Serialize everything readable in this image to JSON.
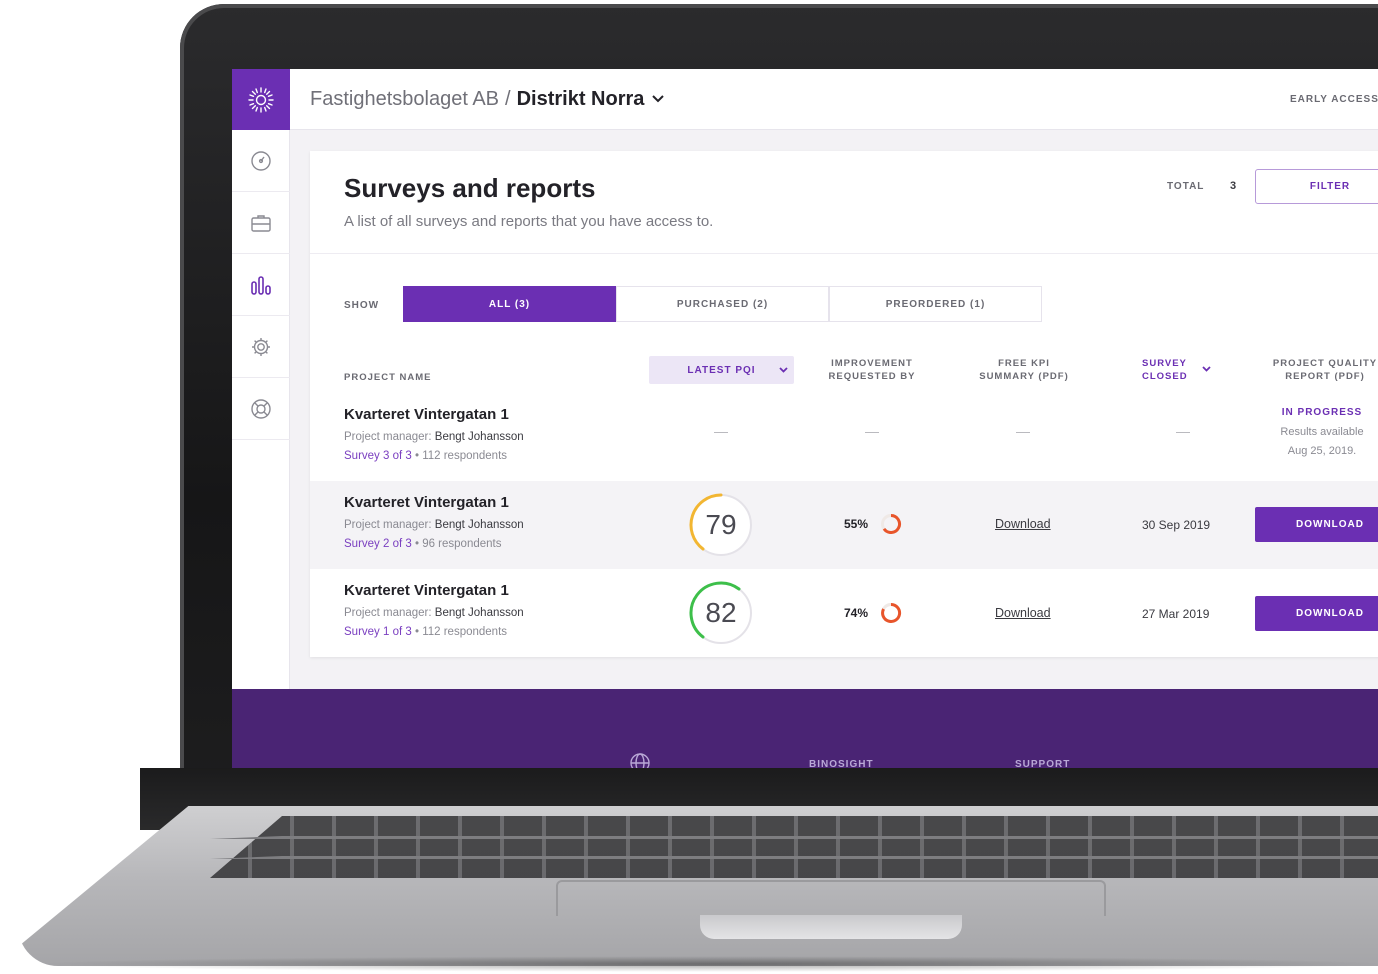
{
  "header": {
    "org": "Fastighetsbolaget AB",
    "separator": "/",
    "district": "Distrikt Norra",
    "early_access": "EARLY ACCESS"
  },
  "sidebar": {
    "items": [
      {
        "icon": "dashboard-gauge-icon"
      },
      {
        "icon": "briefcase-icon"
      },
      {
        "icon": "bar-chart-icon",
        "active": true
      },
      {
        "icon": "gear-icon"
      },
      {
        "icon": "lifebuoy-icon"
      }
    ]
  },
  "page": {
    "title": "Surveys and reports",
    "subtitle": "A list of all surveys and reports that you have access to.",
    "total_label": "TOTAL",
    "total_value": "3",
    "filter_label": "FILTER"
  },
  "show": {
    "label": "SHOW",
    "options": [
      "ALL (3)",
      "PURCHASED (2)",
      "PREORDERED (1)"
    ],
    "selected": "ALL (3)"
  },
  "table": {
    "columns": {
      "project_name": "PROJECT NAME",
      "latest_pqi": "LATEST PQI",
      "improvement_line1": "IMPROVEMENT",
      "improvement_line2": "REQUESTED BY",
      "kpi_line1": "FREE KPI",
      "kpi_line2": "SUMMARY (PDF)",
      "closed_line1": "SURVEY",
      "closed_line2": "CLOSED",
      "quality_line1": "PROJECT QUALITY",
      "quality_line2": "REPORT (PDF)"
    },
    "rows": [
      {
        "name": "Kvarteret Vintergatan 1",
        "manager_label": "Project manager:",
        "manager": "Bengt Johansson",
        "survey": "Survey 3 of 3",
        "respondents": "• 112 respondents",
        "pqi": "—",
        "improvement": "—",
        "kpi": "—",
        "closed": "—",
        "status": "IN PROGRESS",
        "status_line1": "Results available",
        "status_line2": "Aug 25, 2019."
      },
      {
        "name": "Kvarteret Vintergatan 1",
        "manager_label": "Project manager:",
        "manager": "Bengt Johansson",
        "survey": "Survey 2 of 3",
        "respondents": "• 96 respondents",
        "pqi": "79",
        "pqi_color": "#f2b632",
        "improvement": "55%",
        "kpi": "Download",
        "closed": "30 Sep 2019",
        "report": "DOWNLOAD"
      },
      {
        "name": "Kvarteret Vintergatan 1",
        "manager_label": "Project manager:",
        "manager": "Bengt Johansson",
        "survey": "Survey 1 of 3",
        "respondents": "• 112 respondents",
        "pqi": "82",
        "pqi_color": "#3dbf4a",
        "improvement": "74%",
        "kpi": "Download",
        "closed": "27 Mar 2019",
        "report": "DOWNLOAD"
      }
    ]
  },
  "footer": {
    "globe_icon": "globe-icon",
    "links": [
      "BINOSIGHT",
      "SUPPORT"
    ]
  },
  "colors": {
    "brand": "#6b2fb3",
    "footer": "#4a2474",
    "ring_orange": "#e8552b"
  }
}
